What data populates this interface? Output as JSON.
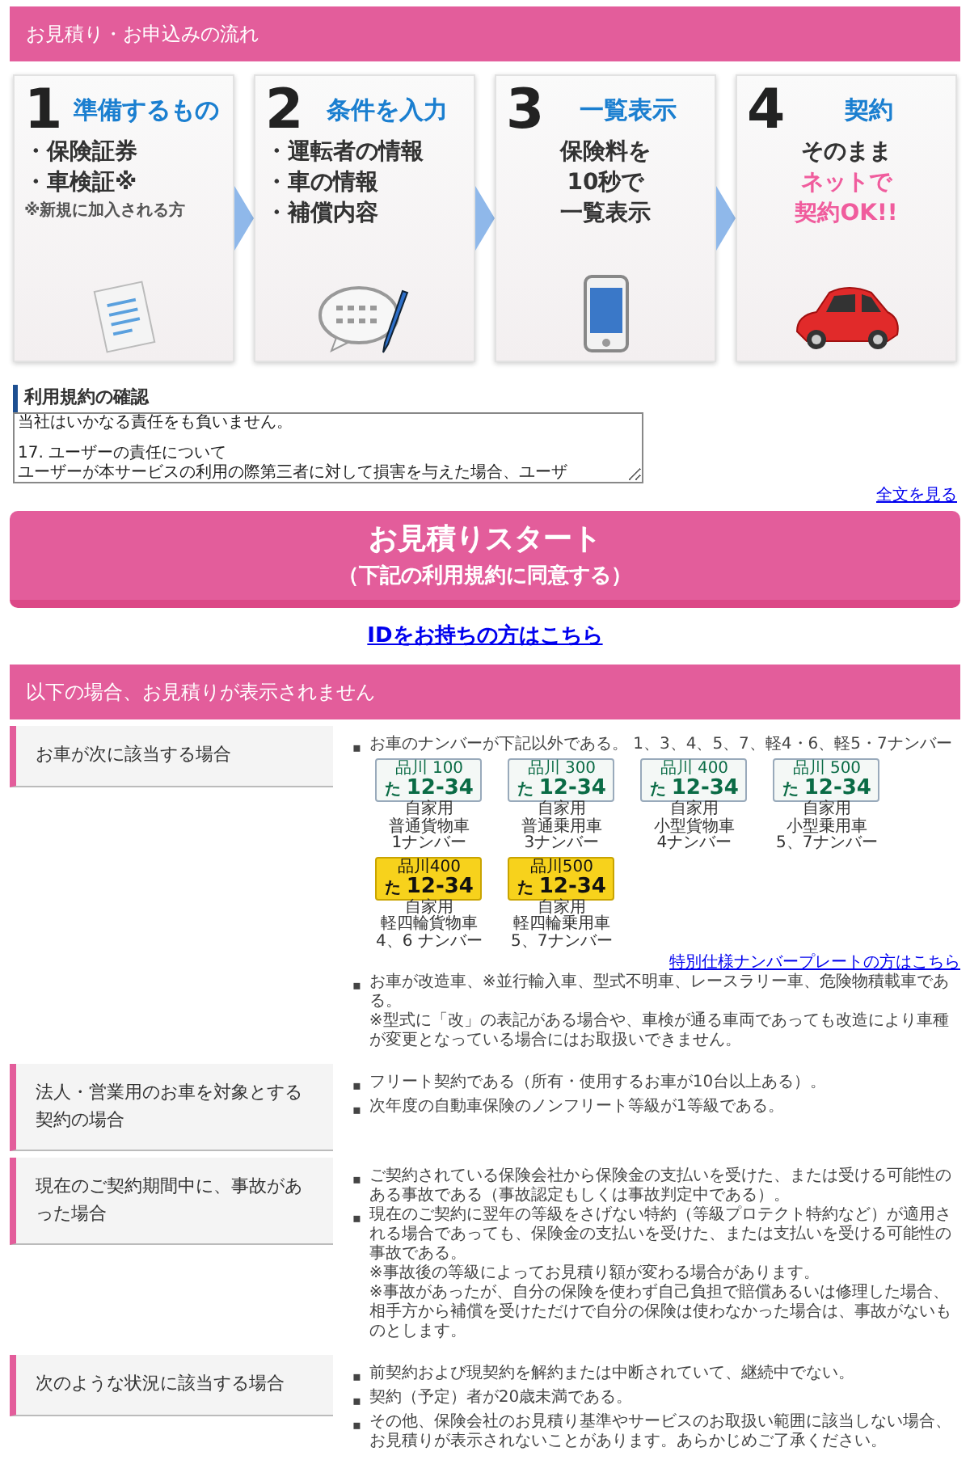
{
  "flow_header": {
    "title": "お見積り・お申込みの流れ"
  },
  "steps": [
    {
      "number": "1",
      "title": "準備するもの",
      "lines": [
        {
          "kind": "bullet",
          "text": "・保険証券"
        },
        {
          "kind": "bullet",
          "text": "・車検証※"
        },
        {
          "kind": "note",
          "text": "※新規に加入される方"
        }
      ]
    },
    {
      "number": "2",
      "title": "条件を入力",
      "lines": [
        {
          "kind": "bullet",
          "text": "・運転者の情報"
        },
        {
          "kind": "bullet",
          "text": "・車の情報"
        },
        {
          "kind": "bullet",
          "text": "・補償内容"
        }
      ]
    },
    {
      "number": "3",
      "title": "一覧表示",
      "lines": [
        {
          "kind": "center",
          "text": "保険料を"
        },
        {
          "kind": "center",
          "text": "**10秒**で"
        },
        {
          "kind": "center",
          "text": "一覧表示"
        }
      ]
    },
    {
      "number": "4",
      "title": "契約",
      "lines": [
        {
          "kind": "center",
          "text": "そのまま"
        },
        {
          "kind": "accent",
          "text": "ネットで"
        },
        {
          "kind": "accent",
          "text": "契約OK!!"
        }
      ]
    }
  ],
  "terms": {
    "title": "利用規約の確認",
    "lines": [
      "当社はいかなる責任をも負いません。",
      "17.  ユーザーの責任について",
      "ユーザーが本サービスの利用の際第三者に対して損害を与えた場合、ユーザ"
    ],
    "full_text_link": "全文を見る"
  },
  "start_button": {
    "label": "お見積りスタート",
    "sublabel": "（下記の利用規約に同意する）"
  },
  "id_link": "IDをお持ちの方はこちら",
  "exclusions": {
    "title": "以下の場合、お見積りが表示されません",
    "rows": [
      {
        "label": "お車が次に該当する場合",
        "items": [
          {
            "marker": "▪",
            "text": "お車のナンバーが下記以外である。 1、3、4、5、7、軽4・6、軽5・7ナンバー",
            "plates": [
              {
                "color": "#f4f8f6",
                "region": "品川 100",
                "kana": "た",
                "number": "12-34",
                "caption": [
                  "自家用",
                  "普通貨物車",
                  "1ナンバー"
                ]
              },
              {
                "color": "#f4f8f6",
                "region": "品川 300",
                "kana": "た",
                "number": "12-34",
                "caption": [
                  "自家用",
                  "普通乗用車",
                  "3ナンバー"
                ]
              },
              {
                "color": "#f4f8f6",
                "region": "品川 400",
                "kana": "た",
                "number": "12-34",
                "caption": [
                  "自家用",
                  "小型貨物車",
                  "4ナンバー"
                ]
              },
              {
                "color": "#f4f8f6",
                "region": "品川 500",
                "kana": "た",
                "number": "12-34",
                "caption": [
                  "自家用",
                  "小型乗用車",
                  "5、7ナンバー"
                ]
              },
              {
                "color": "#f7d21c",
                "region": "品川400",
                "kana": "た",
                "number": "12-34",
                "caption": [
                  "自家用",
                  "軽四輪貨物車",
                  "4、6 ナンバー"
                ]
              },
              {
                "color": "#f7d21c",
                "region": "品川500",
                "kana": "た",
                "number": "12-34",
                "caption": [
                  "自家用",
                  "軽四輪乗用車",
                  "5、7ナンバー"
                ]
              }
            ],
            "link": "特別仕様ナンバープレートの方はこちら"
          },
          {
            "marker": "▪",
            "text": "お車が改造車、※並行輸入車、型式不明車、レースラリー車、危険物積載車である。",
            "notes": [
              "※型式に「改」の表記がある場合や、車検が通る車両であっても改造により車種が変更となっている場合にはお取扱いできません。"
            ]
          }
        ]
      },
      {
        "label": "法人・営業用のお車を対象とする契約の場合",
        "items": [
          {
            "marker": "▪",
            "text": "フリート契約である（所有・使用するお車が10台以上ある）。"
          },
          {
            "marker": "▪",
            "text": "次年度の自動車保険のノンフリート等級が1等級である。"
          }
        ]
      },
      {
        "label": "現在のご契約期間中に、事故があった場合",
        "items": [
          {
            "marker": "▪",
            "text": "ご契約されている保険会社から保険金の支払いを受けた、または受ける可能性のある事故である（事故認定もしくは事故判定中である）。"
          },
          {
            "marker": "▪",
            "text": "現在のご契約に翌年の等級をさげない特約（等級プロテクト特約など）が適用される場合であっても、保険金の支払いを受けた、または支払いを受ける可能性の事故である。",
            "notes": [
              "※事故後の等級によってお見積り額が変わる場合があります。",
              "※事故があったが、自分の保険を使わず自己負担で賠償あるいは修理した場合、相手方から補償を受けただけで自分の保険は使わなかった場合は、事故がないものとします。"
            ]
          }
        ]
      },
      {
        "label": "次のような状況に該当する場合",
        "items": [
          {
            "marker": "▪",
            "text": "前契約および現契約を解約または中断されていて、継続中でない。"
          },
          {
            "marker": "▪",
            "text": "契約（予定）者が20歳未満である。"
          },
          {
            "marker": "▪",
            "text": "その他、保険会社のお見積り基準やサービスのお取扱い範囲に該当しない場合、お見積りが表示されないことがあります。あらかじめご了承ください。"
          }
        ]
      }
    ]
  }
}
